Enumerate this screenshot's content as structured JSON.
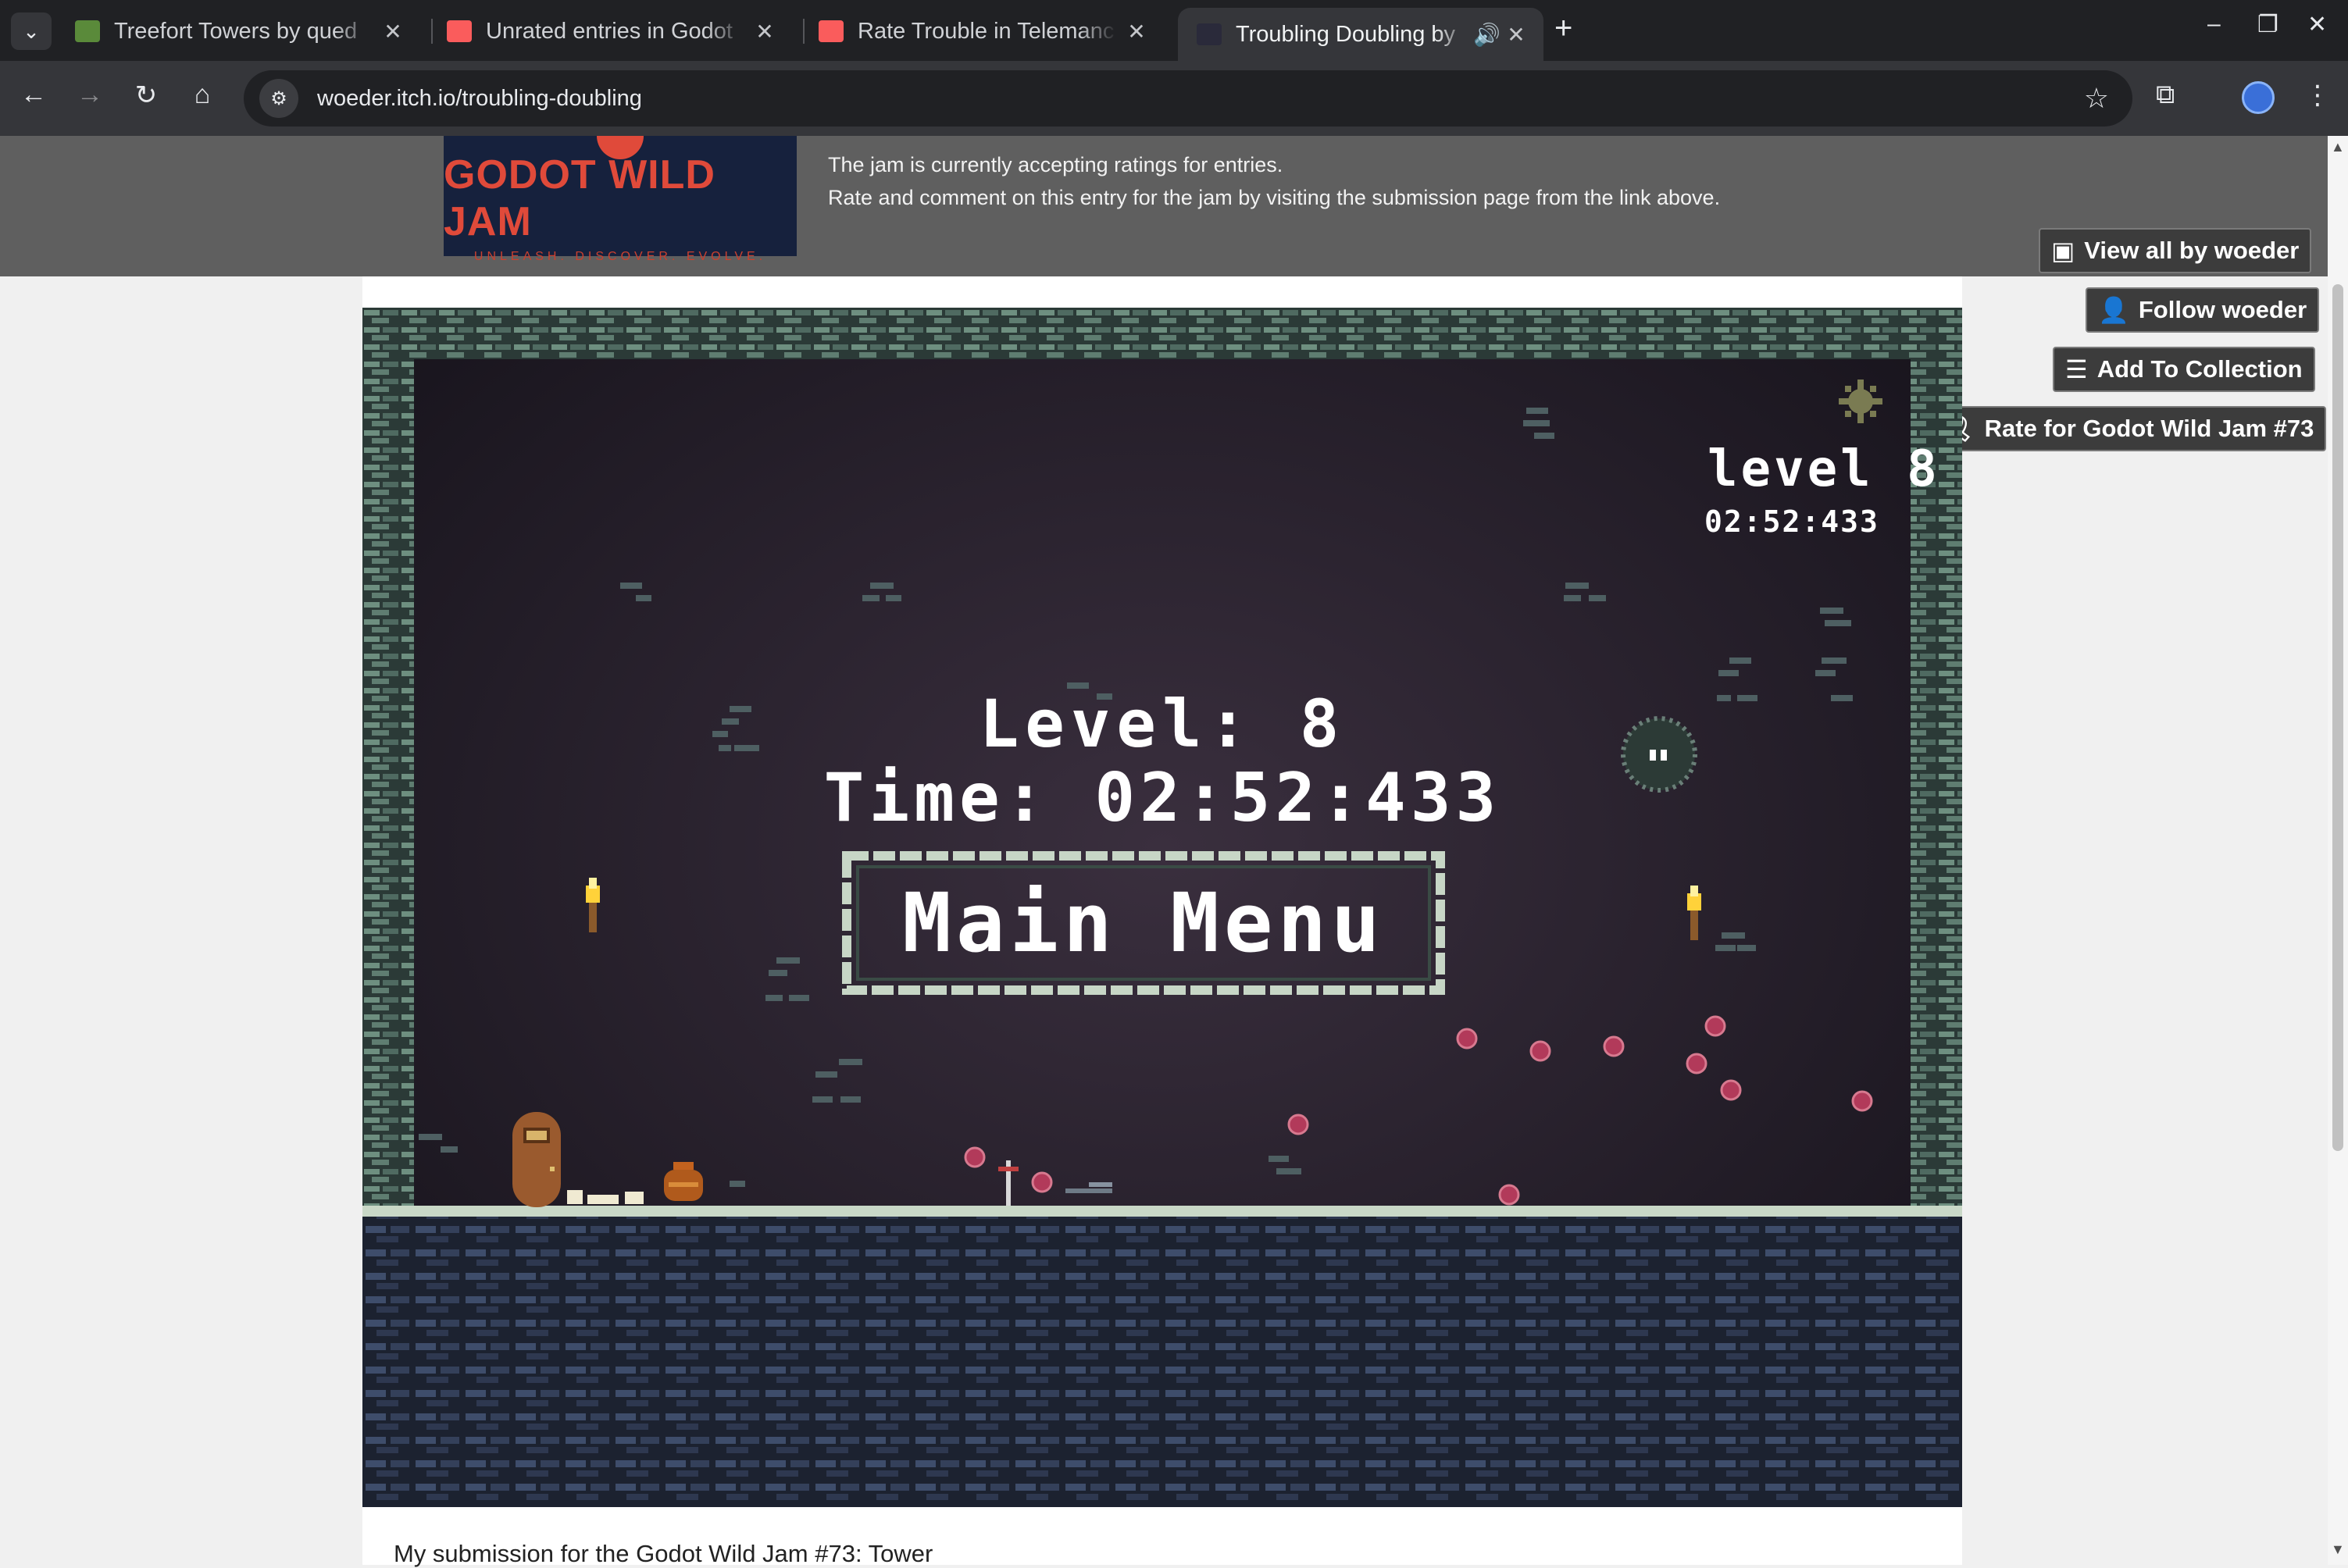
{
  "browser": {
    "tabs": [
      {
        "title": "Treefort Towers by qued",
        "active": false
      },
      {
        "title": "Unrated entries in Godot",
        "active": false
      },
      {
        "title": "Rate Trouble in Telemanc",
        "active": false
      },
      {
        "title": "Troubling Doubling by",
        "active": true
      }
    ],
    "url": "woeder.itch.io/troubling-doubling"
  },
  "jam": {
    "logo_title": "GODOT WILD JAM",
    "logo_tagline": "UNLEASH. DISCOVER. EVOLVE.",
    "line1": "The jam is currently accepting ratings for entries.",
    "line2": "Rate and comment on this entry for the jam by visiting the submission page from the link above."
  },
  "actions": {
    "view_all": "View all by woeder",
    "follow": "Follow woeder",
    "add_collection": "Add To Collection",
    "rate": "Rate for Godot Wild Jam #73"
  },
  "game": {
    "hud_level": "level 8",
    "hud_time": "02:52:433",
    "level_text": "Level: 8",
    "time_text": "Time: 02:52:433",
    "main_menu": "Main Menu"
  },
  "description": "My submission for the Godot Wild Jam #73: Tower"
}
